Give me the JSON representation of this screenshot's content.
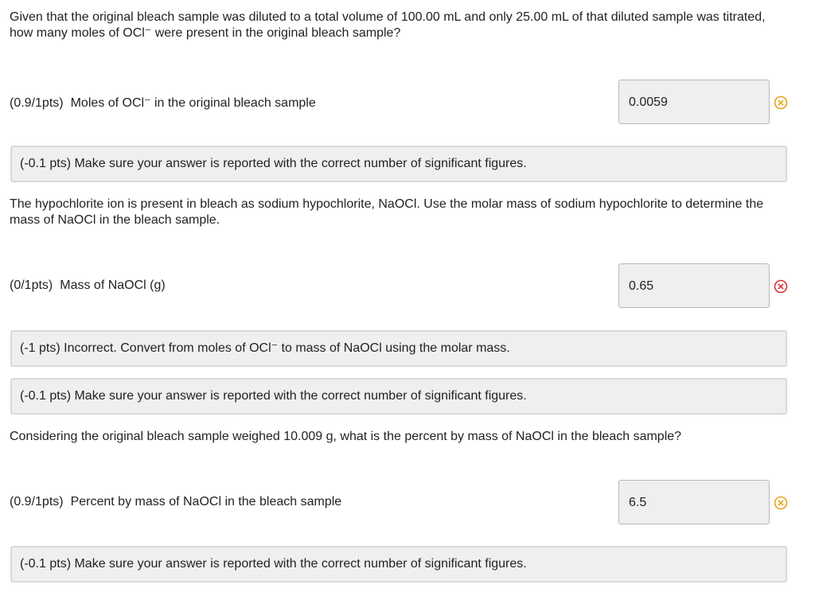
{
  "sections": [
    {
      "question": "Given that the original bleach sample was diluted to a total volume of 100.00 mL and only 25.00 mL of that diluted sample was titrated, how many moles of OCl⁻ were present in the original bleach sample?",
      "score": "(0.9/1pts)",
      "label": "Moles of OCl⁻ in the original bleach sample",
      "answer": "0.0059",
      "status": "partial",
      "status_icon": "x-circle-icon",
      "status_color": "#e8a317",
      "feedback": [
        "(-0.1 pts) Make sure your answer is reported with the correct number of significant figures."
      ]
    },
    {
      "question": "The hypochlorite ion is present in bleach as sodium hypochlorite, NaOCl. Use the molar mass of sodium hypochlorite to determine the mass of NaOCl in the bleach sample.",
      "score": "(0/1pts)",
      "label": "Mass of NaOCl (g)",
      "answer": "0.65",
      "status": "incorrect",
      "status_icon": "x-circle-icon",
      "status_color": "#d9343a",
      "feedback": [
        "(-1 pts) Incorrect. Convert from moles of OCl⁻ to mass of NaOCl using the molar mass.",
        "(-0.1 pts) Make sure your answer is reported with the correct number of significant figures."
      ]
    },
    {
      "question": "Considering the original bleach sample weighed 10.009 g, what is the percent by mass of NaOCl in the bleach sample?",
      "score": "(0.9/1pts)",
      "label": "Percent by mass of NaOCl in the bleach sample",
      "answer": "6.5",
      "status": "partial",
      "status_icon": "x-circle-icon",
      "status_color": "#e8a317",
      "feedback": [
        "(-0.1 pts) Make sure your answer is reported with the correct number of significant figures."
      ]
    }
  ]
}
